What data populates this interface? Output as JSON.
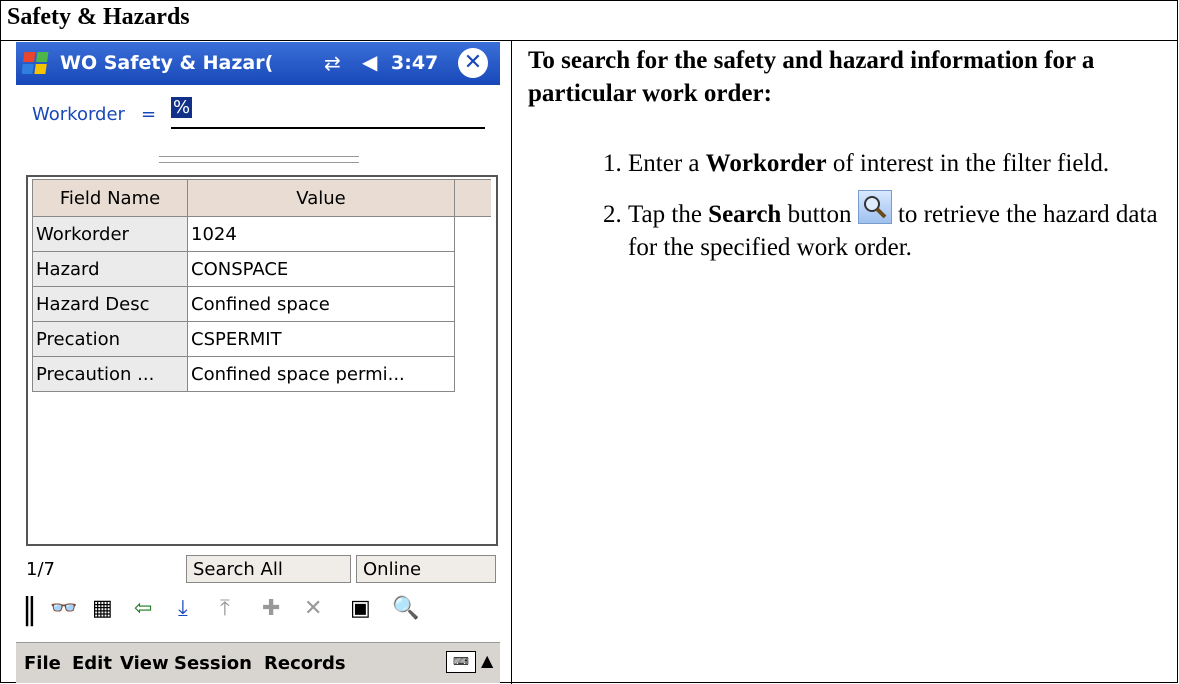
{
  "document": {
    "section_title": "Safety & Hazards"
  },
  "pda": {
    "app_title": "WO Safety & Hazar(",
    "clock": "3:47",
    "filter": {
      "label": "Workorder",
      "operator": "=",
      "value": "%"
    },
    "grid": {
      "headers": [
        "Field Name",
        "Value"
      ],
      "rows": [
        {
          "field": "Workorder",
          "value": "1024"
        },
        {
          "field": "Hazard",
          "value": "CONSPACE"
        },
        {
          "field": "Hazard Desc",
          "value": "Confined space"
        },
        {
          "field": "Precation",
          "value": "CSPERMIT"
        },
        {
          "field": "Precaution ...",
          "value": "Confined space permi..."
        }
      ]
    },
    "status": {
      "page": "1/7",
      "search_mode": "Search All",
      "connection": "Online"
    },
    "toolbar_icons": [
      "grip-icon",
      "glasses-icon",
      "calendar-icon",
      "back-arrow-icon",
      "list-in-icon",
      "list-out-icon",
      "add-icon",
      "delete-icon",
      "save-icon",
      "search-icon"
    ],
    "menu": [
      "File",
      "Edit",
      "View",
      "Session",
      "Records"
    ]
  },
  "instructions": {
    "heading": "To search for the safety and hazard information for a particular work order:",
    "step1": {
      "pre": "Enter a ",
      "bold": "Workorder",
      "post": " of interest in the filter field."
    },
    "step2": {
      "pre": "Tap the ",
      "bold": "Search",
      "mid": " button ",
      "post": " to retrieve the hazard data for the specified work order."
    }
  }
}
